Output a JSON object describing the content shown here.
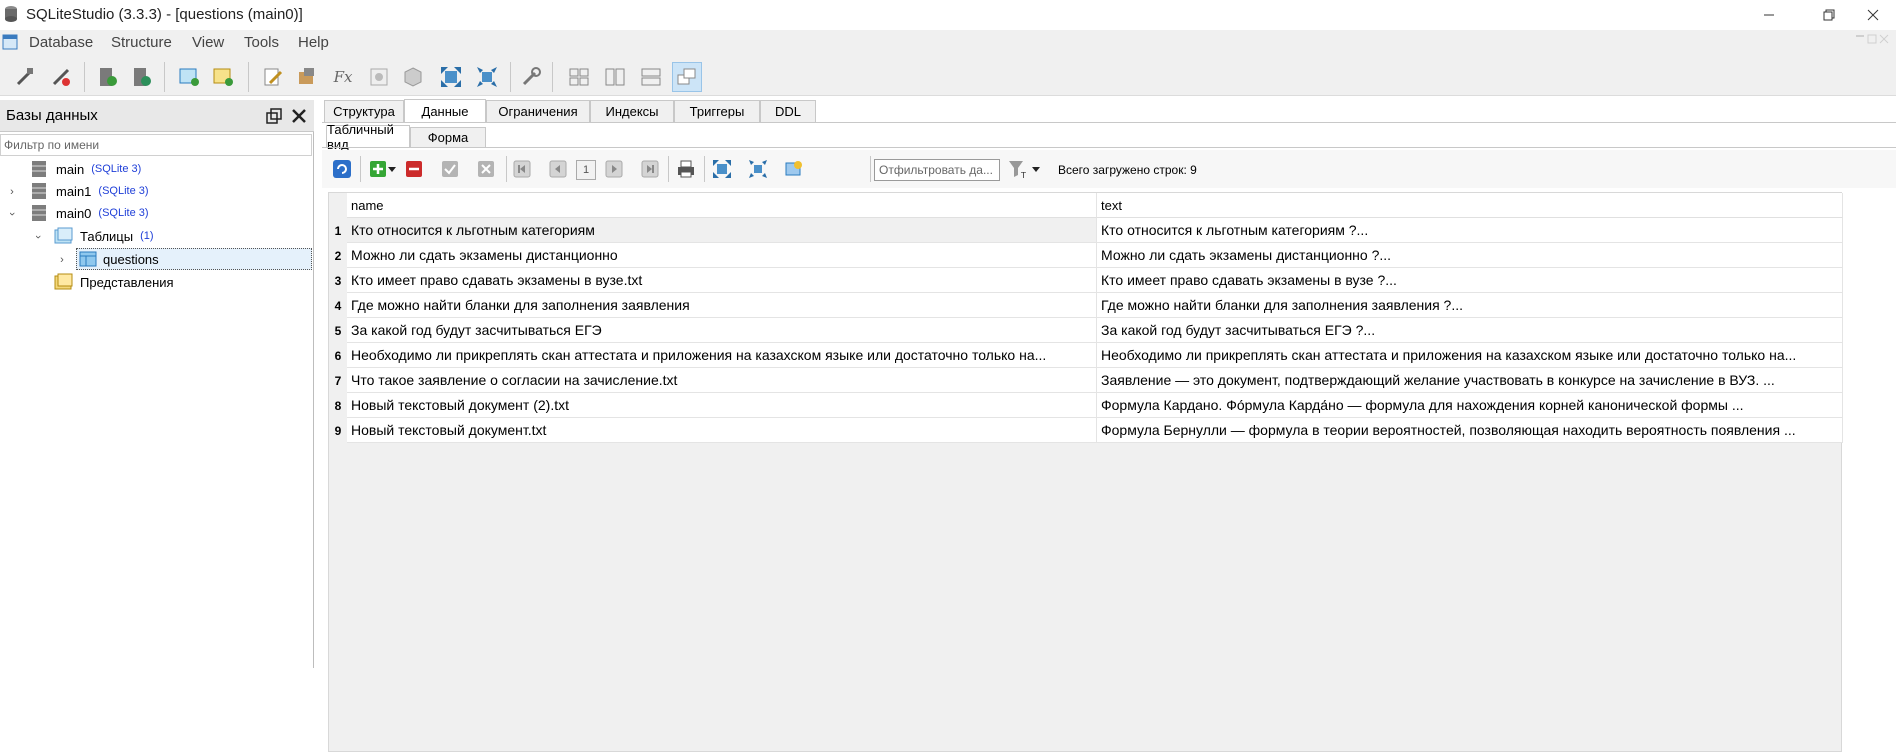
{
  "window": {
    "title": "SQLiteStudio (3.3.3) - [questions (main0)]",
    "minimize_icon": "minimize-icon",
    "restore_icon": "restore-icon",
    "close_icon": "close-icon"
  },
  "menu": {
    "items": [
      "Database",
      "Structure",
      "View",
      "Tools",
      "Help"
    ]
  },
  "db_panel": {
    "title": "Базы данных",
    "filter_placeholder": "Фильтр по имени",
    "tree": [
      {
        "label": "main",
        "badge": "(SQLite 3)",
        "expanded": false
      },
      {
        "label": "main1",
        "badge": "(SQLite 3)",
        "expanded": false
      },
      {
        "label": "main0",
        "badge": "(SQLite 3)",
        "expanded": true
      },
      {
        "label": "Таблицы",
        "badge": "(1)"
      },
      {
        "label": "questions",
        "selected": true
      },
      {
        "label": "Представления"
      }
    ]
  },
  "tabs": [
    "Структура",
    "Данные",
    "Ограничения",
    "Индексы",
    "Триггеры",
    "DDL"
  ],
  "active_tab": "Данные",
  "subtabs": [
    "Табличный вид",
    "Форма"
  ],
  "active_subtab": "Табличный вид",
  "data_toolbar": {
    "page_number": "1",
    "filter_placeholder": "Отфильтровать да...",
    "rows_loaded": "Всего загружено строк: 9"
  },
  "grid": {
    "columns": [
      "name",
      "text"
    ],
    "rows": [
      {
        "num": "1",
        "name": "Кто относится к льготным категориям",
        "text": "Кто относится к льготным категориям ?..."
      },
      {
        "num": "2",
        "name": "Можно ли сдать экзамены дистанционно",
        "text": "Можно ли сдать экзамены дистанционно ?..."
      },
      {
        "num": "3",
        "name": "Кто имеет право сдавать экзамены в вузе.txt",
        "text": "Кто имеет право сдавать экзамены в вузе ?..."
      },
      {
        "num": "4",
        "name": "Где можно найти бланки для заполнения заявления",
        "text": "Где можно найти бланки для заполнения заявления ?..."
      },
      {
        "num": "5",
        "name": "За какой год будут засчитываться ЕГЭ",
        "text": "За какой год будут засчитываться ЕГЭ ?..."
      },
      {
        "num": "6",
        "name": "Необходимо ли прикреплять скан аттестата и приложения на казахском языке или достаточно только на...",
        "text": "Необходимо ли прикреплять скан аттестата и приложения на казахском языке или достаточно только на..."
      },
      {
        "num": "7",
        "name": "Что такое заявление о согласии на зачисление.txt",
        "text": "Заявление — это документ, подтверждающий желание участвовать в конкурсе на зачисление в ВУЗ. ..."
      },
      {
        "num": "8",
        "name": "Новый текстовый документ (2).txt",
        "text": "Формула Кардано. Фо́рмула Карда́но — формула для нахождения корней канонической формы ..."
      },
      {
        "num": "9",
        "name": "Новый текстовый документ.txt",
        "text": "Формула Бернулли — формула в теории вероятностей, позволяющая находить вероятность появления ..."
      }
    ]
  }
}
